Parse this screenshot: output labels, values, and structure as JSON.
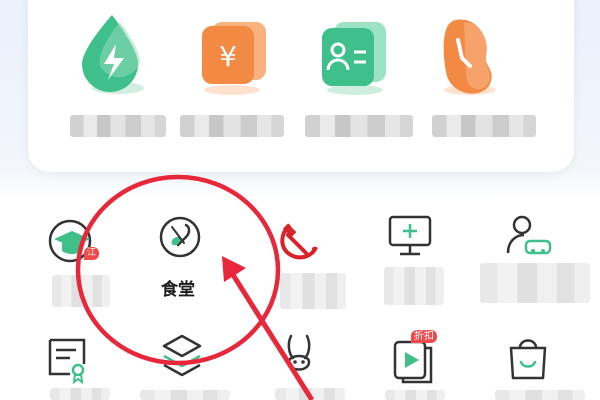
{
  "top_tiles": [
    {
      "icon": "lightning-drop-icon",
      "color": "#3fbf8a",
      "label": ""
    },
    {
      "icon": "yuan-card-icon",
      "color": "#f38a44",
      "label": "",
      "symbol": "¥"
    },
    {
      "icon": "id-card-icon",
      "color": "#3fbf8a",
      "label": ""
    },
    {
      "icon": "bean-icon",
      "color": "#f38a44",
      "label": ""
    }
  ],
  "grid": {
    "row1": [
      {
        "icon": "graduation-cap-icon",
        "badge": "江",
        "label": ""
      },
      {
        "icon": "spoon-fork-icon",
        "label": "食堂"
      },
      {
        "icon": "hammer-sickle-icon",
        "label": ""
      },
      {
        "icon": "monitor-plus-icon",
        "label": ""
      },
      {
        "icon": "user-car-icon",
        "label": ""
      }
    ],
    "row2": [
      {
        "icon": "certificate-icon",
        "label": ""
      },
      {
        "icon": "layers-icon",
        "label": ""
      },
      {
        "icon": "rabbit-icon",
        "label": ""
      },
      {
        "icon": "video-book-icon",
        "badge": "折扣",
        "label": ""
      },
      {
        "icon": "shopping-bag-icon",
        "label": ""
      }
    ]
  },
  "colors": {
    "accent_green": "#3fbf8a",
    "accent_orange": "#f38a44",
    "annotation_red": "#e8283a"
  }
}
